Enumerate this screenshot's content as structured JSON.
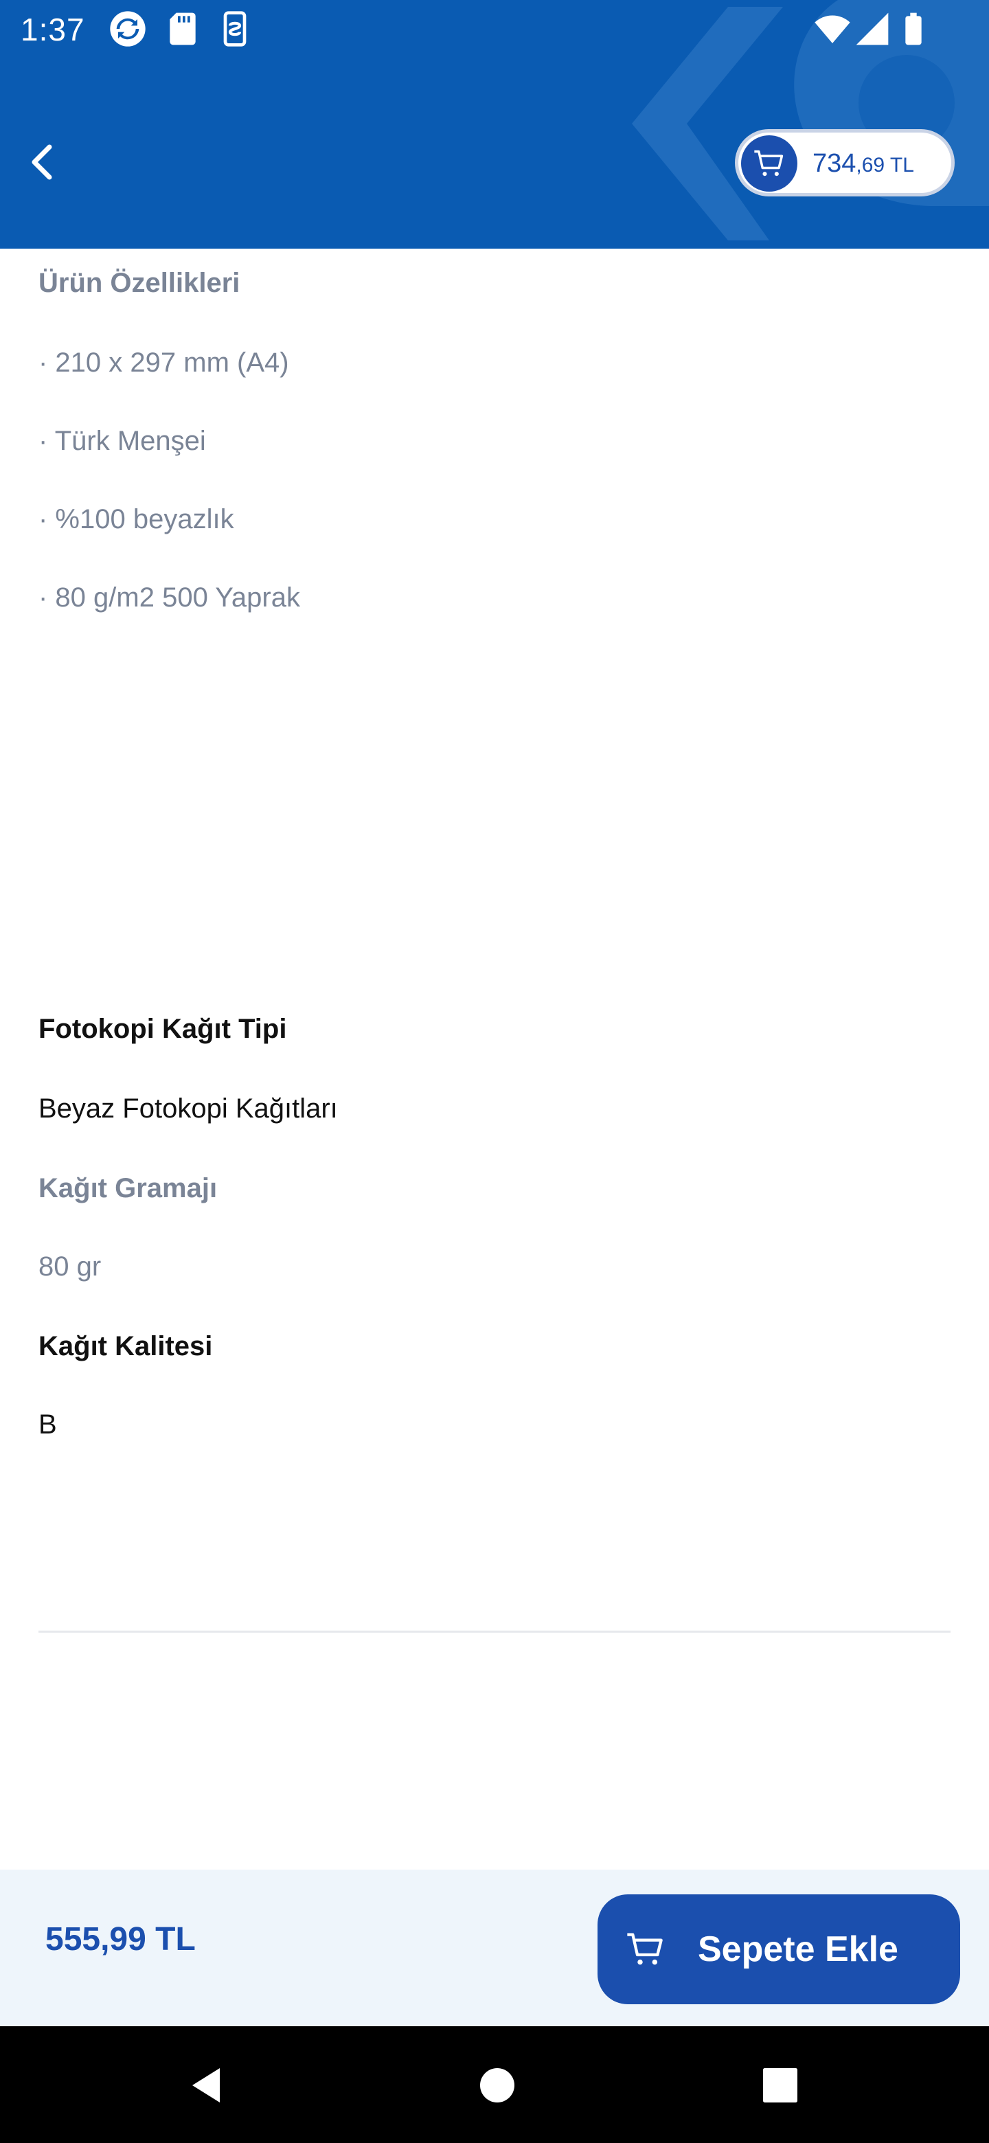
{
  "status_bar": {
    "time": "1:37",
    "left_icons": [
      "sync-icon",
      "sd-card-icon",
      "screen-record-icon"
    ],
    "right_icons": [
      "wifi-icon",
      "signal-icon",
      "battery-icon"
    ]
  },
  "header": {
    "background_color": "#0a5bb2",
    "back_icon": "chevron-left-icon",
    "cart": {
      "icon": "cart-icon",
      "total_main": "734",
      "total_small": ",69 TL"
    }
  },
  "features": {
    "title": "Ürün Özellikleri",
    "items": [
      "· 210 x 297 mm (A4)",
      "· Türk Menşei",
      "· %100 beyazlık",
      "· 80 g/m2 500 Yaprak"
    ]
  },
  "attributes": [
    {
      "label": "Fotokopi Kağıt Tipi",
      "value": "Beyaz Fotokopi Kağıtları"
    },
    {
      "label": "Kağıt Gramajı",
      "value": "80 gr"
    },
    {
      "label": "Kağıt Kalitesi",
      "value": "B"
    }
  ],
  "bottom_bar": {
    "price": "555,99 TL",
    "add_to_cart_label": "Sepete Ekle",
    "accent_color": "#1b4fae",
    "background_color": "#eef5fb"
  },
  "nav_bar": {
    "icons": [
      "nav-back-icon",
      "nav-home-icon",
      "nav-recents-icon"
    ]
  }
}
